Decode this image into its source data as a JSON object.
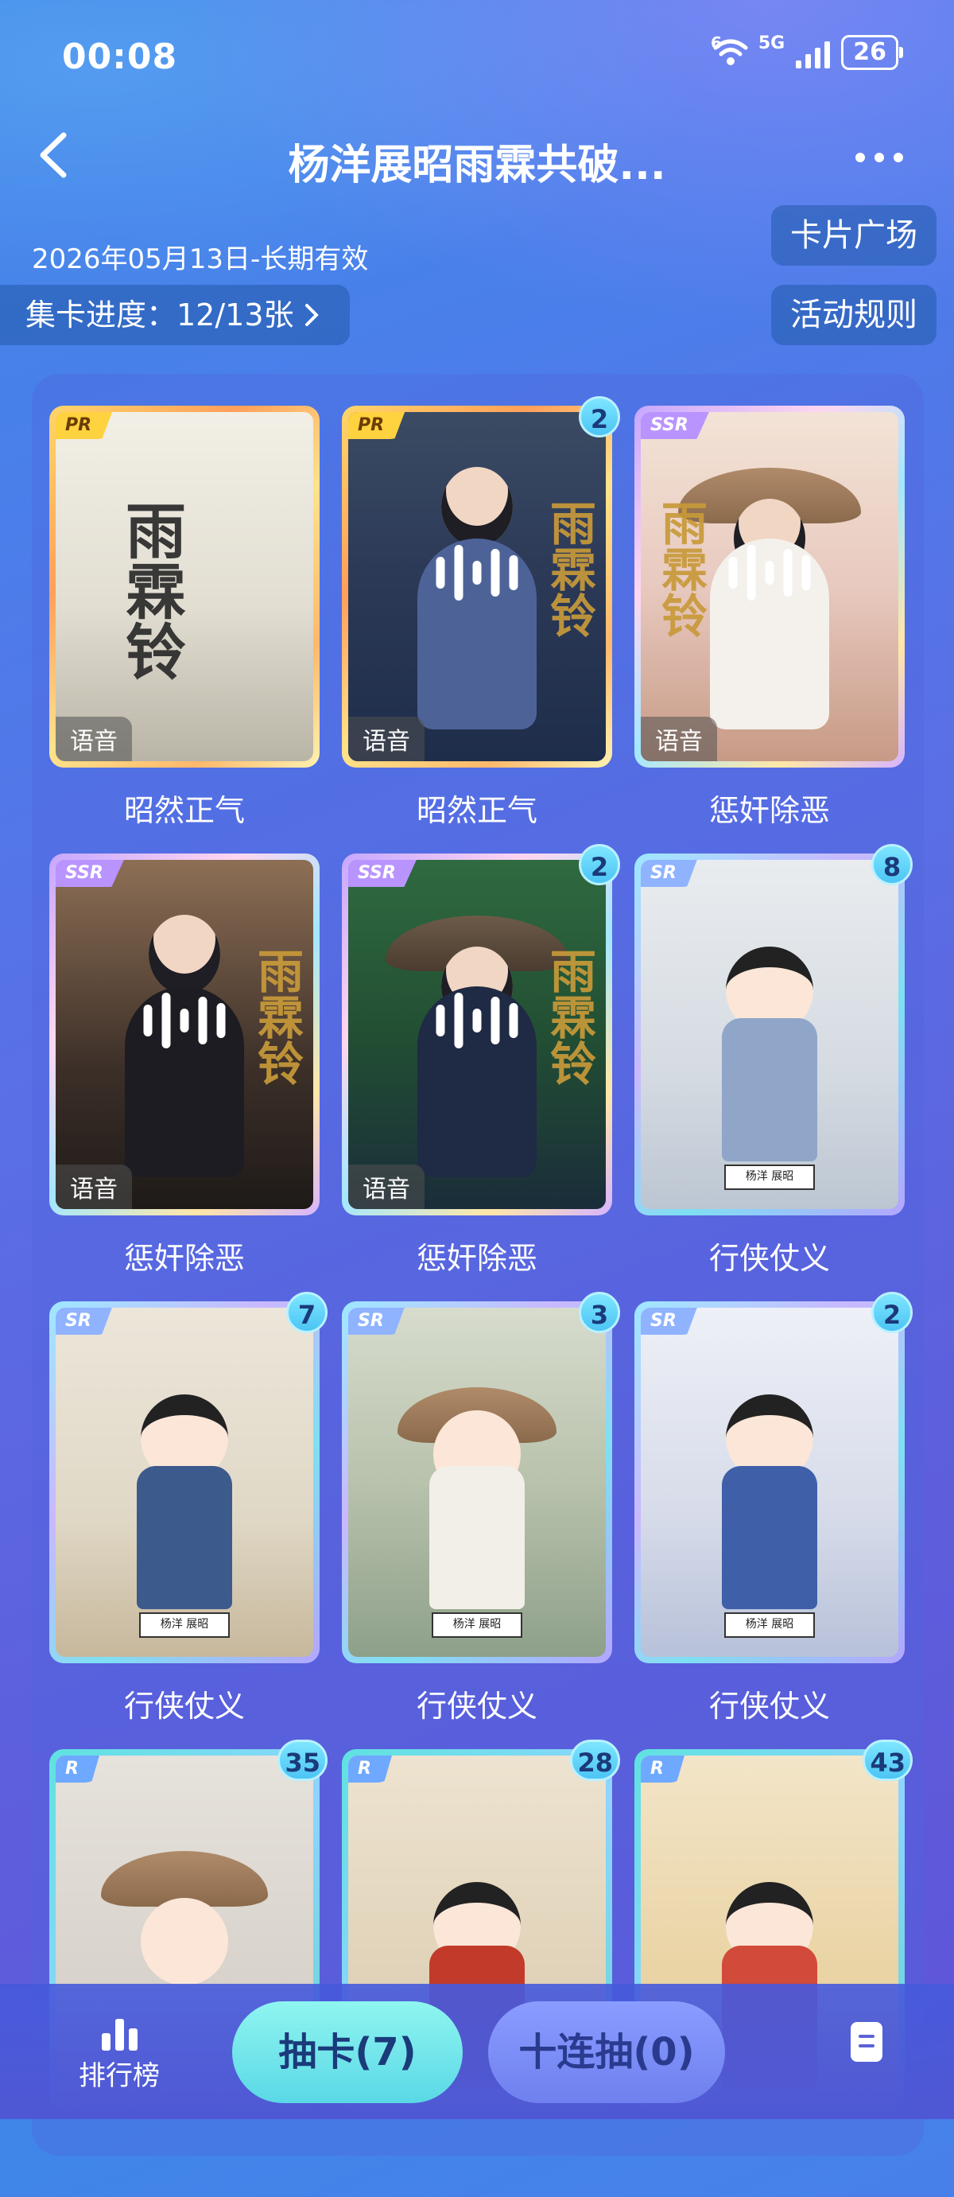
{
  "status_bar": {
    "time": "00:08",
    "wifi_label": "6",
    "network_label": "5G",
    "battery": "26"
  },
  "header": {
    "title": "杨洋展昭雨霖共破..."
  },
  "info": {
    "date": "2026年05月13日-长期有效",
    "progress": "集卡进度：12/13张",
    "card_plaza": "卡片广场",
    "rules": "活动规则"
  },
  "cards": [
    {
      "rarity": "PR",
      "name": "昭然正气",
      "count": "",
      "voice": "语音",
      "has_wave": false
    },
    {
      "rarity": "PR",
      "name": "昭然正气",
      "count": "2",
      "voice": "语音",
      "has_wave": true
    },
    {
      "rarity": "SSR",
      "name": "惩奸除恶",
      "count": "",
      "voice": "语音",
      "has_wave": true
    },
    {
      "rarity": "SSR",
      "name": "惩奸除恶",
      "count": "",
      "voice": "语音",
      "has_wave": true
    },
    {
      "rarity": "SSR",
      "name": "惩奸除恶",
      "count": "2",
      "voice": "语音",
      "has_wave": true
    },
    {
      "rarity": "SR",
      "name": "行侠仗义",
      "count": "8",
      "voice": "",
      "has_wave": false
    },
    {
      "rarity": "SR",
      "name": "行侠仗义",
      "count": "7",
      "voice": "",
      "has_wave": false
    },
    {
      "rarity": "SR",
      "name": "行侠仗义",
      "count": "3",
      "voice": "",
      "has_wave": false
    },
    {
      "rarity": "SR",
      "name": "行侠仗义",
      "count": "2",
      "voice": "",
      "has_wave": false
    },
    {
      "rarity": "R",
      "name": "",
      "count": "35",
      "voice": "",
      "has_wave": false
    },
    {
      "rarity": "R",
      "name": "",
      "count": "28",
      "voice": "",
      "has_wave": false
    },
    {
      "rarity": "R",
      "name": "",
      "count": "43",
      "voice": "",
      "has_wave": false
    }
  ],
  "bottom_bar": {
    "ranking": "排行榜",
    "draw": "抽卡(7)",
    "ten_draw": "十连抽(0)"
  }
}
